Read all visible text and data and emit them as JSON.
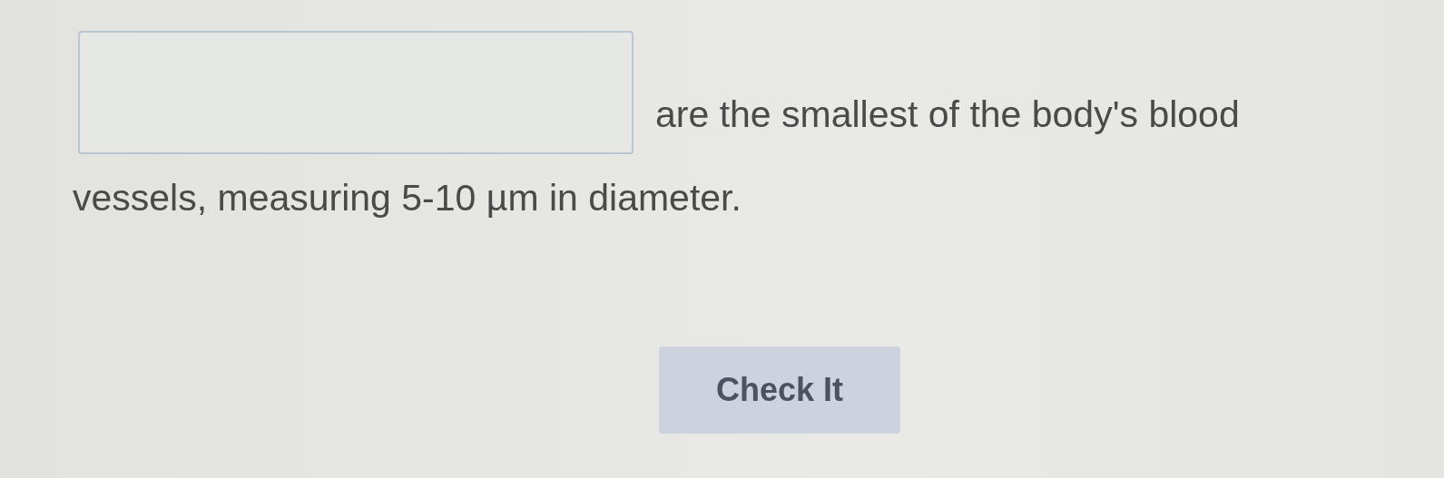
{
  "question": {
    "lines": [
      "are the smallest of the body's blood",
      "vessels, measuring 5-10 µm in diameter."
    ]
  },
  "button": {
    "label": "Check It"
  }
}
